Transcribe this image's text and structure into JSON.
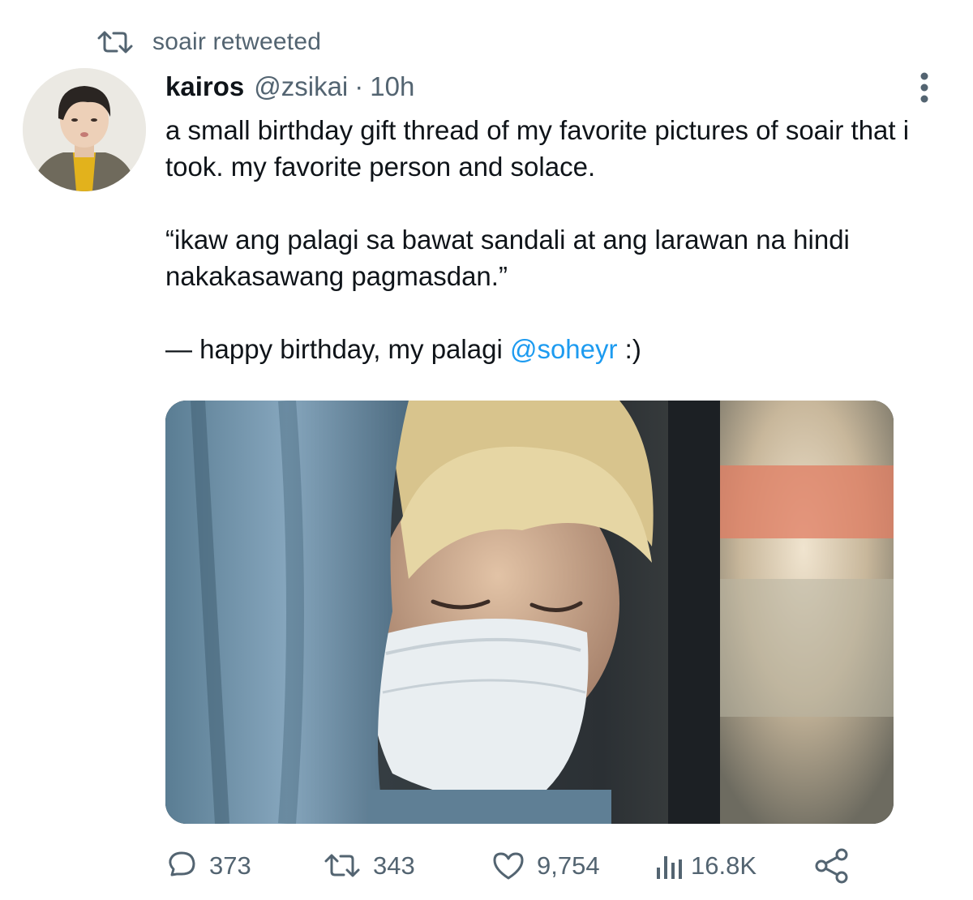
{
  "retweet_banner": {
    "icon": "retweet-icon",
    "text": "soair retweeted"
  },
  "tweet": {
    "author": {
      "name": "kairos",
      "handle": "@zsikai",
      "separator": "·",
      "time": "10h",
      "avatar": "avatar-photo"
    },
    "text": {
      "paragraph1": "a small birthday gift thread of my favorite pictures of soair that i took. my favorite person and solace.",
      "paragraph2": "“ikaw ang palagi sa bawat sandali at ang larawan na hindi nakakasawang pagmasdan.”",
      "paragraph3_prefix": "— happy birthday, my palagi ",
      "paragraph3_mention": "@soheyr",
      "paragraph3_suffix": " :)"
    },
    "media": {
      "type": "photo"
    },
    "actions": {
      "reply": {
        "icon": "reply-icon",
        "count": "373"
      },
      "retweet": {
        "icon": "retweet-icon",
        "count": "343"
      },
      "like": {
        "icon": "heart-icon",
        "count": "9,754"
      },
      "views": {
        "icon": "analytics-icon",
        "count": "16.8K"
      },
      "share": {
        "icon": "share-icon"
      }
    },
    "more_icon": "more-vertical-icon"
  },
  "colors": {
    "text": "#0f1419",
    "secondary": "#536471",
    "link": "#1d9bf0",
    "background": "#ffffff"
  }
}
